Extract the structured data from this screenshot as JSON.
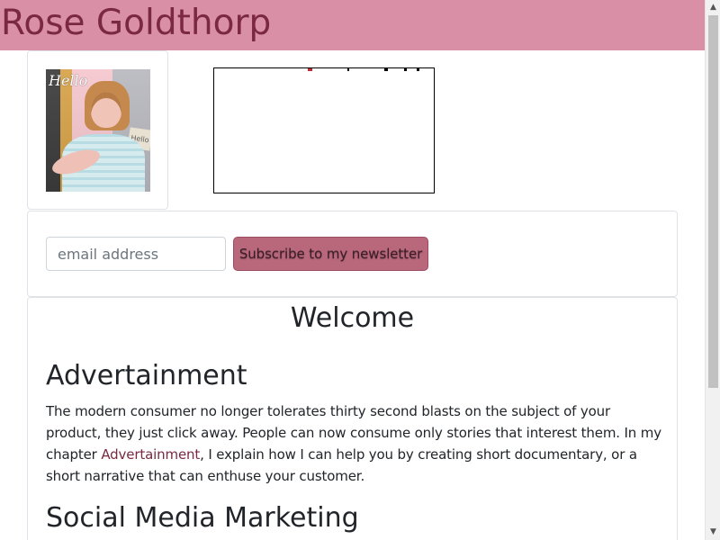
{
  "header": {
    "title": "Rose Goldthorp",
    "background_color": "#d98fa6",
    "title_color": "#7b2942"
  },
  "profile": {
    "photo_text": "Hello",
    "photo_sign_text": "Hello"
  },
  "newsletter": {
    "email_placeholder": "email address",
    "email_value": "",
    "subscribe_label": "Subscribe to my newsletter",
    "button_color": "#b9687c"
  },
  "main": {
    "welcome_title": "Welcome",
    "advertainment_title": "Advertainment",
    "advertainment_text_before_link": "The modern consumer no longer tolerates thirty second blasts on the subject of your product, they just click away. People can now consume only stories that interest them. In my chapter ",
    "advertainment_link": "Advertainment",
    "advertainment_text_after_link": ", I explain how I can help you by creating short documentary, or a short narrative that can enthuse your customer.",
    "social_media_title": "Social Media Marketing",
    "link_color": "#7b2942"
  },
  "icons": {
    "scroll_up": "chevron-up-icon",
    "scroll_down": "chevron-down-icon"
  }
}
